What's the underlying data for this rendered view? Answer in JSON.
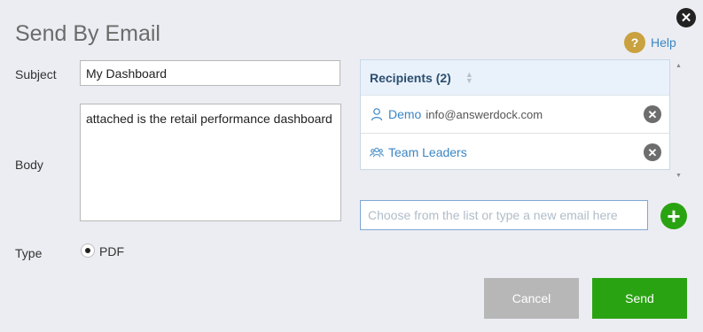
{
  "dialog": {
    "title": "Send By Email",
    "close_icon": "close-icon",
    "help": {
      "icon": "help-icon",
      "label": "Help"
    }
  },
  "form": {
    "subject_label": "Subject",
    "subject_value": "My Dashboard",
    "body_label": "Body",
    "body_value": "attached is the retail performance dashboard",
    "type_label": "Type",
    "type_option": "PDF",
    "type_selected": true
  },
  "recipients": {
    "header": "Recipients (2)",
    "items": [
      {
        "kind": "user",
        "icon": "user-icon",
        "name": "Demo",
        "email": "info@answerdock.com"
      },
      {
        "kind": "group",
        "icon": "group-icon",
        "name": "Team Leaders",
        "email": ""
      }
    ],
    "input_placeholder": "Choose from the list or type a new email here",
    "input_value": ""
  },
  "buttons": {
    "cancel": "Cancel",
    "send": "Send"
  },
  "colors": {
    "background": "#ecedf2",
    "accent_green": "#2aa312",
    "link_blue": "#3a86c4",
    "help_gold": "#c9a13f",
    "cancel_gray": "#b7b7b7"
  }
}
